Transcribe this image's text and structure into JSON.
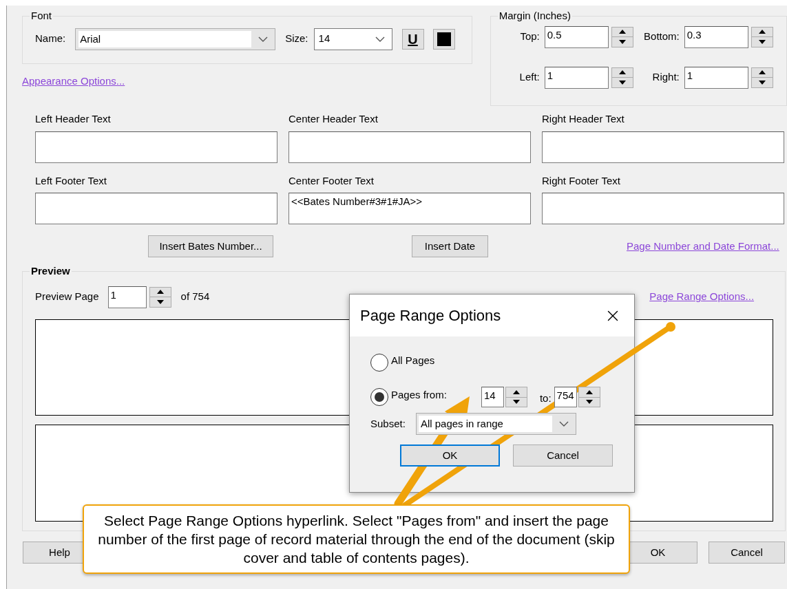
{
  "font_group": {
    "title": "Font",
    "name_label": "Name:",
    "name_value": "Arial",
    "size_label": "Size:",
    "size_value": "14",
    "underline_label": "U"
  },
  "appearance_link": "Appearance Options...",
  "margin_group": {
    "title": "Margin (Inches)",
    "fields": [
      {
        "label": "Top:",
        "value": "0.5"
      },
      {
        "label": "Bottom:",
        "value": "0.3"
      },
      {
        "label": "Left:",
        "value": "1"
      },
      {
        "label": "Right:",
        "value": "1"
      }
    ]
  },
  "header_fields": [
    {
      "label": "Left Header Text"
    },
    {
      "label": "Center Header Text"
    },
    {
      "label": "Right Header Text"
    }
  ],
  "footer_fields": [
    {
      "label": "Left Footer Text"
    },
    {
      "label": "Center Footer Text",
      "value": "<<Bates Number#3#1#JA>>"
    },
    {
      "label": "Right Footer Text"
    }
  ],
  "insert_buttons": [
    "Insert Bates Number...",
    "Insert Date"
  ],
  "format_link": "Page Number and Date Format...",
  "preview": {
    "title": "Preview",
    "page_label": "Preview Page",
    "page_value": "1",
    "of_text": "of 754",
    "range_link": "Page Range Options..."
  },
  "dialog": {
    "title": "Page Range Options",
    "options": [
      {
        "label": "All Pages",
        "selected": false
      },
      {
        "label": "Pages from:",
        "selected": true
      }
    ],
    "from_value": "14",
    "to_label": "to:",
    "to_value": "754",
    "subset_label": "Subset:",
    "subset_value": "All pages in range",
    "buttons": [
      {
        "label": "OK",
        "default": true
      },
      {
        "label": "Cancel",
        "default": false
      }
    ]
  },
  "footer_buttons": [
    "Help",
    "OK",
    "Cancel"
  ],
  "callout": {
    "text": "Select Page Range Options hyperlink. Select \"Pages from\" and insert the page number of the first page of record material through the end of the document (skip cover and table of contents pages)."
  }
}
